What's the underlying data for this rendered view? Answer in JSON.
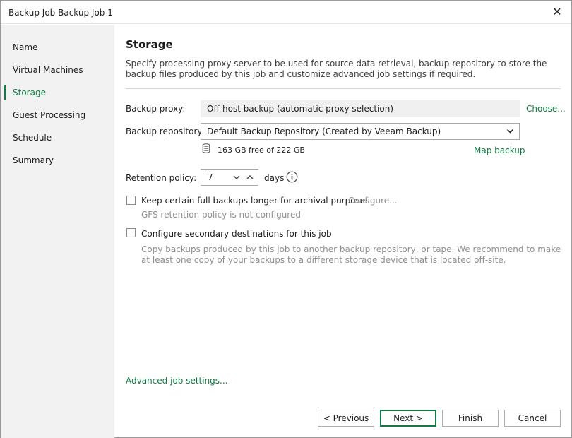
{
  "window": {
    "title": "Backup Job Backup Job 1",
    "close_label": "✕"
  },
  "sidebar": {
    "items": [
      {
        "label": "Name",
        "active": false
      },
      {
        "label": "Virtual Machines",
        "active": false
      },
      {
        "label": "Storage",
        "active": true
      },
      {
        "label": "Guest Processing",
        "active": false
      },
      {
        "label": "Schedule",
        "active": false
      },
      {
        "label": "Summary",
        "active": false
      }
    ]
  },
  "main": {
    "heading": "Storage",
    "description": "Specify processing proxy server to be used for source data retrieval, backup repository to store the backup files produced by this job and customize advanced job settings if required.",
    "proxy": {
      "label": "Backup proxy:",
      "value": "Off-host backup (automatic proxy selection)",
      "choose_link": "Choose..."
    },
    "repository": {
      "label": "Backup repository:",
      "selected": "Default Backup Repository (Created by Veeam Backup)",
      "free_space": "163 GB free of 222 GB",
      "map_link": "Map backup",
      "icon": "database-icon"
    },
    "retention": {
      "label": "Retention policy:",
      "value": "7",
      "unit": "days",
      "info_icon": "info-icon"
    },
    "archival": {
      "checked": false,
      "label": "Keep certain full backups longer for archival purposes",
      "configure_link": "Configure...",
      "status": "GFS retention policy is not configured"
    },
    "secondary": {
      "checked": false,
      "label": "Configure secondary destinations for this job",
      "description": "Copy backups produced by this job to another backup repository, or tape. We recommend to make at least one copy of your backups to a different storage device that is located off-site."
    },
    "advanced_link": "Advanced job settings..."
  },
  "footer": {
    "previous": "< Previous",
    "next": "Next >",
    "finish": "Finish",
    "cancel": "Cancel"
  },
  "colors": {
    "accent": "#107c42",
    "sidebar_bg": "#f2f2f2",
    "muted_text": "#8f8f8f"
  }
}
